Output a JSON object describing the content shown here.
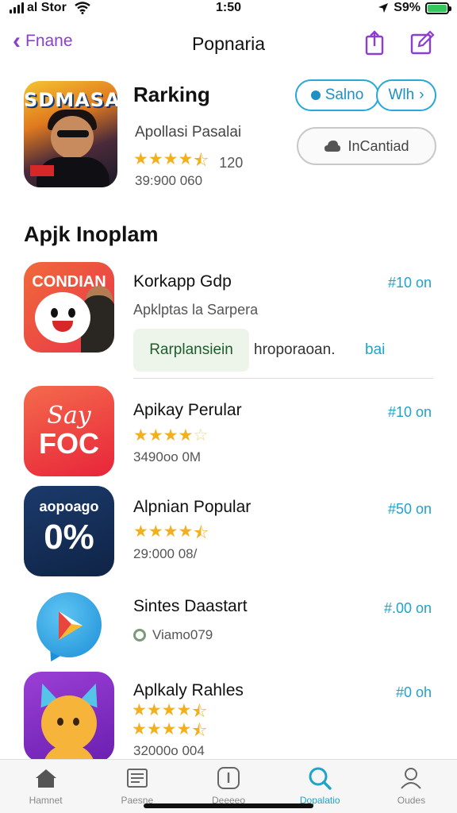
{
  "status_bar": {
    "carrier": "al Stor",
    "time": "1:50",
    "battery_percent": "S9%"
  },
  "nav": {
    "back_label": "Fnane",
    "title": "Popnaria"
  },
  "featured": {
    "art_text": "SDMASAL",
    "title": "Rarking",
    "subtitle": "Apollasi Pasalai",
    "rating": 4.5,
    "rating_count": "120",
    "meta": "39:900 060",
    "pill_a_label": "Salno",
    "pill_b_label": "Wlh",
    "incant_label": "InCantiad"
  },
  "section": {
    "title": "Apjk Inoplam"
  },
  "apps": [
    {
      "name": "Korkapp Gdp",
      "price": "#10 on",
      "subtitle": "Apklptas la Sarpera",
      "icon_label": "CONDIAN",
      "chip_label": "Rarplansiein",
      "chip_text": "hroporaoan.",
      "chip_link": "bai"
    },
    {
      "name": "Apikay Perular",
      "price": "#10 on",
      "rating": 4,
      "meta": "3490oo 0M",
      "icon_l1": "Say",
      "icon_l2": "FOC"
    },
    {
      "name": "Alpnian Popular",
      "price": "#50 on",
      "rating": 4.5,
      "meta": "29:000 08/",
      "icon_l1": "aopoago",
      "icon_l2": "0%"
    },
    {
      "name": "Sintes Daastart",
      "price": "#.00 on",
      "verified_text": "Viamo079"
    },
    {
      "name": "Aplkaly Rahles",
      "price": "#0 oh",
      "rating": 4.5,
      "meta": "32000o 004"
    }
  ],
  "tabs": [
    {
      "label": "Hamnet",
      "icon": "home-icon"
    },
    {
      "label": "Paesne",
      "icon": "news-icon"
    },
    {
      "label": "Deeeeo",
      "icon": "info-icon"
    },
    {
      "label": "Dopalatio",
      "icon": "search-icon"
    },
    {
      "label": "Oudes",
      "icon": "person-icon"
    }
  ],
  "colors": {
    "accent_purple": "#8a3fd1",
    "accent_blue": "#1fa3c9",
    "star": "#f2b01e"
  }
}
